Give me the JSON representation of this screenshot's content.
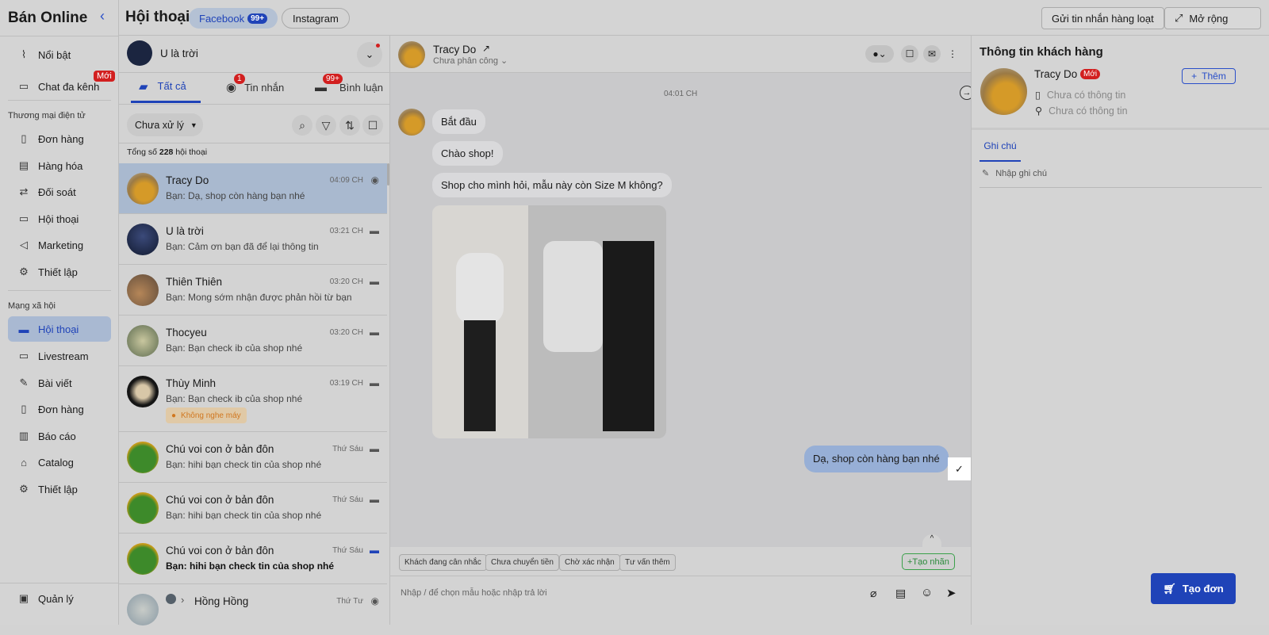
{
  "sidebar": {
    "brand": "Bán Online",
    "items_top": [
      {
        "label": "Nổi bật",
        "icon": "chart-icon"
      },
      {
        "label": "Chat đa kênh",
        "icon": "chat-icon",
        "badge": "Mới"
      }
    ],
    "section_ecom": "Thương mại điện tử",
    "ecom_items": [
      "Đơn hàng",
      "Hàng hóa",
      "Đối soát",
      "Hội thoại",
      "Marketing",
      "Thiết lập"
    ],
    "section_social": "Mạng xã hội",
    "social_items": [
      "Hội thoại",
      "Livestream",
      "Bài viết",
      "Đơn hàng",
      "Báo cáo",
      "Catalog",
      "Thiết lập"
    ],
    "bottom": "Quản lý"
  },
  "topbar": {
    "title": "Hội thoại",
    "facebook": "Facebook",
    "facebook_badge": "99+",
    "instagram": "Instagram",
    "bulk": "Gửi tin nhắn hàng loạt",
    "expand": "Mở rộng"
  },
  "list": {
    "page_name": "U là trời",
    "tabs": [
      {
        "label": "Tất cả"
      },
      {
        "label": "Tin nhắn",
        "badge": "1"
      },
      {
        "label": "Bình luận",
        "badge": "99+"
      }
    ],
    "filter": "Chưa xử lý",
    "total_prefix": "Tổng số",
    "total": "228",
    "total_suffix": "hội thoại",
    "conversations": [
      {
        "name": "Tracy Do",
        "preview": "Bạn: Dạ, shop còn hàng bạn nhé",
        "time": "04:09 CH"
      },
      {
        "name": "U là trời",
        "preview": "Bạn: Cảm ơn bạn đã để lại thông tin",
        "time": "03:21 CH"
      },
      {
        "name": "Thiên Thiên",
        "preview": "Bạn: Mong sớm nhận được phản hồi từ bạn",
        "time": "03:20 CH"
      },
      {
        "name": "Thocyeu",
        "preview": "Bạn: Bạn check ib của shop nhé",
        "time": "03:20 CH"
      },
      {
        "name": "Thùy Minh",
        "preview": "Bạn: Bạn check ib của shop nhé",
        "time": "03:19 CH",
        "tag": "Không nghe máy"
      },
      {
        "name": "Chú voi con ở bản đôn",
        "preview": "Bạn: hihi bạn check tin của shop nhé",
        "time": "Thứ Sáu"
      },
      {
        "name": "Chú voi con ở bản đôn",
        "preview": "Bạn: hihi bạn check tin của shop nhé",
        "time": "Thứ Sáu"
      },
      {
        "name": "Chú voi con ở bản đôn",
        "preview": "Bạn: hihi bạn check tin của shop nhé",
        "time": "Thứ Sáu"
      },
      {
        "name": "Hồng Hồng",
        "preview": "",
        "time": "Thứ Tư"
      }
    ]
  },
  "chat": {
    "name": "Tracy Do",
    "assign": "Chưa phân công",
    "time": "04:01 CH",
    "messages": [
      "Bắt đầu",
      "Chào shop!",
      "Shop cho mình hỏi, mẫu này còn Size M không?"
    ],
    "reply": "Dạ, shop còn hàng bạn nhé",
    "quick_replies": [
      "Khách đang cân nhắc",
      "Chưa chuyển tiền",
      "Chờ xác nhận",
      "Tư vấn thêm"
    ],
    "create_label": "+Tạo nhãn",
    "input_placeholder": "Nhập / để chọn mẫu hoặc nhập trả lời"
  },
  "customer": {
    "title": "Thông tin khách hàng",
    "name": "Tracy Do",
    "badge": "Mới",
    "add": "Thêm",
    "phone": "Chưa có thông tin",
    "address": "Chưa có thông tin",
    "tab": "Ghi chú",
    "note_placeholder": "Nhập ghi chú",
    "create_order": "Tạo đơn"
  },
  "colors": {
    "accent": "#1f43b8",
    "red": "#d21f1f",
    "selected": "#a9b9cf"
  }
}
